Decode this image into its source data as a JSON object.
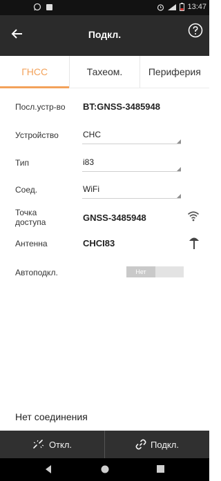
{
  "status_bar": {
    "time": "13:47",
    "icons": [
      "whatsapp-icon",
      "notification-square-icon",
      "alarm-icon",
      "signal-icon",
      "battery-low-icon"
    ]
  },
  "appbar": {
    "title": "Подкл.",
    "back_icon": "arrow-back-icon",
    "help_icon": "help-circle-icon"
  },
  "tabs": [
    {
      "label": "ГНСС",
      "active": true
    },
    {
      "label": "Тахеом.",
      "active": false
    },
    {
      "label": "Периферия",
      "active": false
    }
  ],
  "fields": {
    "device_seq": {
      "label": "Посл.устр-во",
      "value": "BT:GNSS-3485948"
    },
    "device": {
      "label": "Устройство",
      "value": "CHC"
    },
    "type": {
      "label": "Тип",
      "value": "i83"
    },
    "connection": {
      "label": "Соед.",
      "value": "WiFi"
    },
    "access_point": {
      "label": "Точка доступа",
      "value": "GNSS-3485948"
    },
    "antenna": {
      "label": "Антенна",
      "value": "CHCI83"
    },
    "autoconnect": {
      "label": "Автоподкл.",
      "value": "Нет"
    }
  },
  "connection_status": "Нет соединения",
  "bottom_buttons": {
    "disconnect": "Откл.",
    "connect": "Подкл."
  },
  "colors": {
    "accent": "#f3a25a",
    "appbar": "#2b2b2b",
    "bottombar": "#303030"
  }
}
